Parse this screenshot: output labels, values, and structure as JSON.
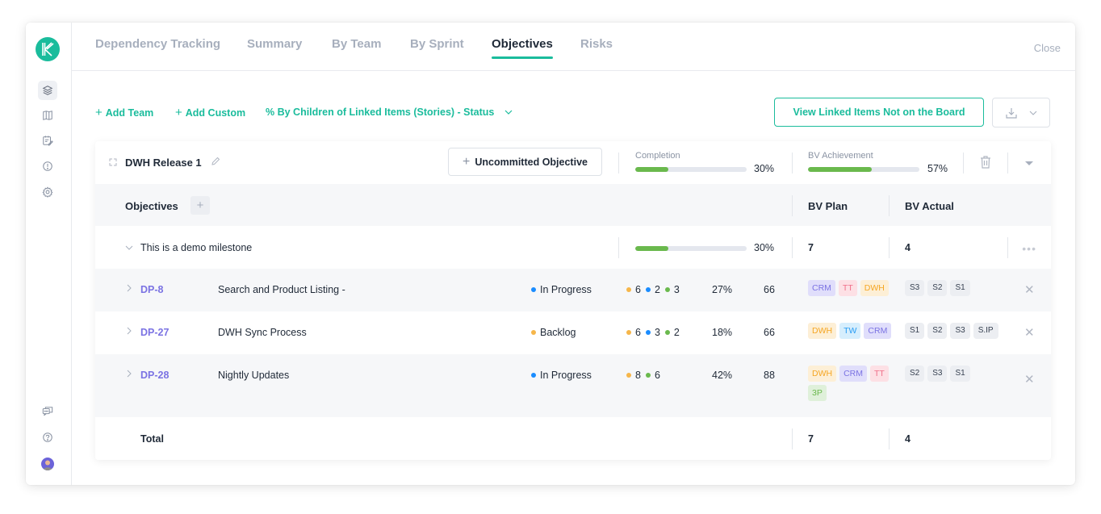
{
  "nav": {
    "tabs": [
      {
        "label": "Dependency Tracking",
        "active": false
      },
      {
        "label": "Summary",
        "active": false
      },
      {
        "label": "By Team",
        "active": false
      },
      {
        "label": "By Sprint",
        "active": false
      },
      {
        "label": "Objectives",
        "active": true
      },
      {
        "label": "Risks",
        "active": false
      }
    ],
    "close_label": "Close"
  },
  "sidebar": {
    "top_icons": [
      "layers-icon",
      "map-icon",
      "calendar-edit-icon",
      "alert-circle-icon",
      "gear-icon"
    ],
    "bottom_icons": [
      "chat-icon",
      "help-icon",
      "avatar"
    ]
  },
  "toolbar": {
    "add_team": "Add Team",
    "add_custom": "Add Custom",
    "mode_select": "% By Children of Linked Items (Stories) - Status",
    "view_linked": "View Linked Items Not on the Board"
  },
  "release": {
    "title": "DWH Release 1",
    "uncommitted_label": "Uncommitted Objective",
    "completion_label": "Completion",
    "completion_pct": "30%",
    "completion_value": 0.3,
    "bv_label": "BV Achievement",
    "bv_pct": "57%",
    "bv_value": 0.57
  },
  "objectives": {
    "header": "Objectives",
    "col_bv_plan": "BV Plan",
    "col_bv_actual": "BV Actual",
    "milestone": {
      "name": "This is a demo milestone",
      "pct": "30%",
      "value": 0.3,
      "bv_plan": "7",
      "bv_actual": "4"
    },
    "rows": [
      {
        "key": "DP-8",
        "title": "Search and Product Listing -",
        "status": "In Progress",
        "status_color": "#1a8cff",
        "counts": [
          {
            "n": "6",
            "color": "#f6b64a"
          },
          {
            "n": "2",
            "color": "#1a8cff"
          },
          {
            "n": "3",
            "color": "#6ab94d"
          }
        ],
        "pct": "27%",
        "value": "66",
        "teams": [
          {
            "label": "CRM",
            "fg": "#7b73e3",
            "bg": "#e0defb"
          },
          {
            "label": "TT",
            "fg": "#f0708a",
            "bg": "#fde0e5"
          },
          {
            "label": "DWH",
            "fg": "#f5a623",
            "bg": "#fdefd6"
          }
        ],
        "sprints": [
          "S3",
          "S2",
          "S1"
        ]
      },
      {
        "key": "DP-27",
        "title": "DWH Sync Process",
        "status": "Backlog",
        "status_color": "#f6b64a",
        "counts": [
          {
            "n": "6",
            "color": "#f6b64a"
          },
          {
            "n": "3",
            "color": "#1a8cff"
          },
          {
            "n": "2",
            "color": "#6ab94d"
          }
        ],
        "pct": "18%",
        "value": "66",
        "teams": [
          {
            "label": "DWH",
            "fg": "#f5a623",
            "bg": "#fdefd6"
          },
          {
            "label": "TW",
            "fg": "#2a9df4",
            "bg": "#d6eefd"
          },
          {
            "label": "CRM",
            "fg": "#7b73e3",
            "bg": "#e0defb"
          }
        ],
        "sprints": [
          "S1",
          "S2",
          "S3",
          "S.IP"
        ]
      },
      {
        "key": "DP-28",
        "title": "Nightly Updates",
        "status": "In Progress",
        "status_color": "#1a8cff",
        "counts": [
          {
            "n": "8",
            "color": "#f6b64a"
          },
          {
            "n": "6",
            "color": "#6ab94d"
          }
        ],
        "pct": "42%",
        "value": "88",
        "teams": [
          {
            "label": "DWH",
            "fg": "#f5a623",
            "bg": "#fdefd6"
          },
          {
            "label": "CRM",
            "fg": "#7b73e3",
            "bg": "#e0defb"
          },
          {
            "label": "TT",
            "fg": "#f0708a",
            "bg": "#fde0e5"
          },
          {
            "label": "3P",
            "fg": "#6ab94d",
            "bg": "#dff0da"
          }
        ],
        "sprints": [
          "S2",
          "S3",
          "S1"
        ]
      }
    ],
    "total": {
      "label": "Total",
      "bv_plan": "7",
      "bv_actual": "4"
    }
  },
  "colors": {
    "accent": "#1abc9c",
    "progress": "#6ab94d",
    "key_link": "#7b73e3"
  }
}
